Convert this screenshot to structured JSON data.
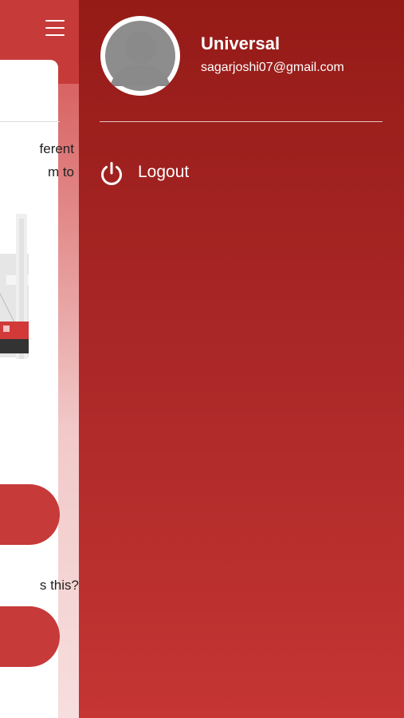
{
  "underlying": {
    "text_line_1": "ferent",
    "text_line_2": "m to",
    "question": "s this?"
  },
  "drawer": {
    "user_name": "Universal",
    "user_email": "sagarjoshi07@gmail.com",
    "menu": [
      {
        "label": "Logout",
        "icon": "power-icon"
      }
    ]
  },
  "colors": {
    "drawer_top": "#951b17",
    "drawer_bottom": "#c43533",
    "accent": "#c63a3a"
  }
}
